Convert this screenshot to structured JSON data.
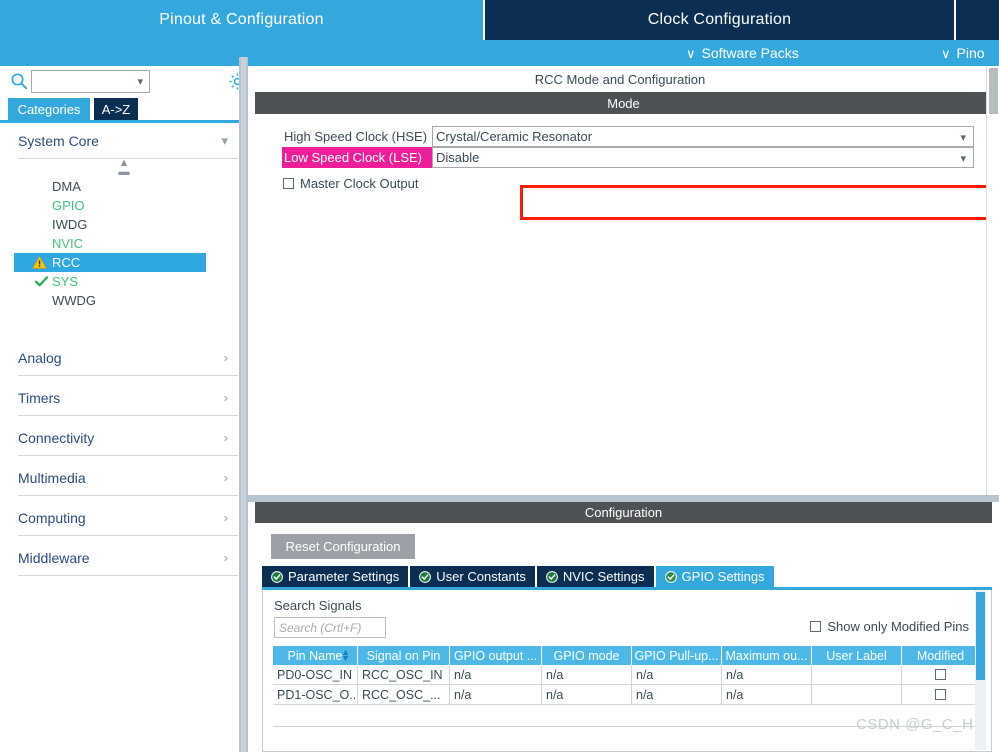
{
  "top_tabs": [
    {
      "label": "Pinout & Configuration",
      "active": true
    },
    {
      "label": "Clock Configuration",
      "active": false
    }
  ],
  "subbar": {
    "software_packs": "Software Packs",
    "pinout": "Pino",
    "chevron": "∨"
  },
  "sidebar": {
    "search": {
      "value": "",
      "placeholder": ""
    },
    "gear_icon": "gear-icon",
    "tabs": [
      {
        "label": "Categories",
        "active": true
      },
      {
        "label": "A->Z",
        "active": false
      }
    ],
    "categories": [
      {
        "label": "System Core",
        "expanded": true
      },
      {
        "label": "Analog",
        "expanded": false
      },
      {
        "label": "Timers",
        "expanded": false
      },
      {
        "label": "Connectivity",
        "expanded": false
      },
      {
        "label": "Multimedia",
        "expanded": false
      },
      {
        "label": "Computing",
        "expanded": false
      },
      {
        "label": "Middleware",
        "expanded": false
      }
    ],
    "peripherals": [
      {
        "label": "DMA",
        "state": "plain",
        "icon": "none"
      },
      {
        "label": "GPIO",
        "state": "green",
        "icon": "none"
      },
      {
        "label": "IWDG",
        "state": "plain",
        "icon": "none"
      },
      {
        "label": "NVIC",
        "state": "green",
        "icon": "none"
      },
      {
        "label": "RCC",
        "state": "selected",
        "icon": "warning-icon"
      },
      {
        "label": "SYS",
        "state": "green",
        "icon": "check-icon"
      },
      {
        "label": "WWDG",
        "state": "plain",
        "icon": "none"
      }
    ]
  },
  "content": {
    "title": "RCC Mode and Configuration",
    "mode_header": "Mode",
    "mode": {
      "hse": {
        "label": "High Speed Clock (HSE)",
        "value": "Crystal/Ceramic Resonator",
        "highlighted": true
      },
      "lse": {
        "label": "Low Speed Clock (LSE)",
        "value": "Disable",
        "label_background": "#ee1e9a"
      },
      "master_clock_output": {
        "label": "Master Clock Output",
        "checked": false
      }
    },
    "configuration": {
      "header": "Configuration",
      "reset_button": "Reset Configuration",
      "tabs": [
        {
          "label": "Parameter Settings",
          "active": false
        },
        {
          "label": "User Constants",
          "active": false
        },
        {
          "label": "NVIC Settings",
          "active": false
        },
        {
          "label": "GPIO Settings",
          "active": true
        }
      ],
      "gpio": {
        "search_label": "Search Signals",
        "search_value": "",
        "search_placeholder": "Search (Crtl+F)",
        "show_only_modified": {
          "label": "Show only Modified Pins",
          "checked": false
        },
        "columns": [
          "Pin Name",
          "Signal on Pin",
          "GPIO output ...",
          "GPIO mode",
          "GPIO Pull-up...",
          "Maximum ou...",
          "User Label",
          "Modified"
        ],
        "rows": [
          {
            "pin_name": "PD0-OSC_IN",
            "signal_on_pin": "RCC_OSC_IN",
            "gpio_output": "n/a",
            "gpio_mode": "n/a",
            "gpio_pullup": "n/a",
            "maximum_output": "n/a",
            "user_label": "",
            "modified": false
          },
          {
            "pin_name": "PD1-OSC_O...",
            "signal_on_pin": "RCC_OSC_...",
            "gpio_output": "n/a",
            "gpio_mode": "n/a",
            "gpio_pullup": "n/a",
            "maximum_output": "n/a",
            "user_label": "",
            "modified": false
          }
        ]
      }
    }
  },
  "watermark": "CSDN @G_C_H",
  "colors": {
    "accent_blue": "#34a8dd",
    "dark_navy": "#0b2e52",
    "panel_header_gray": "#4e5254",
    "highlight_red": "#fb1b09",
    "lse_magenta": "#ee1e9a",
    "green_text": "#3fc27e",
    "grid_header_blue": "#4db8e8"
  }
}
